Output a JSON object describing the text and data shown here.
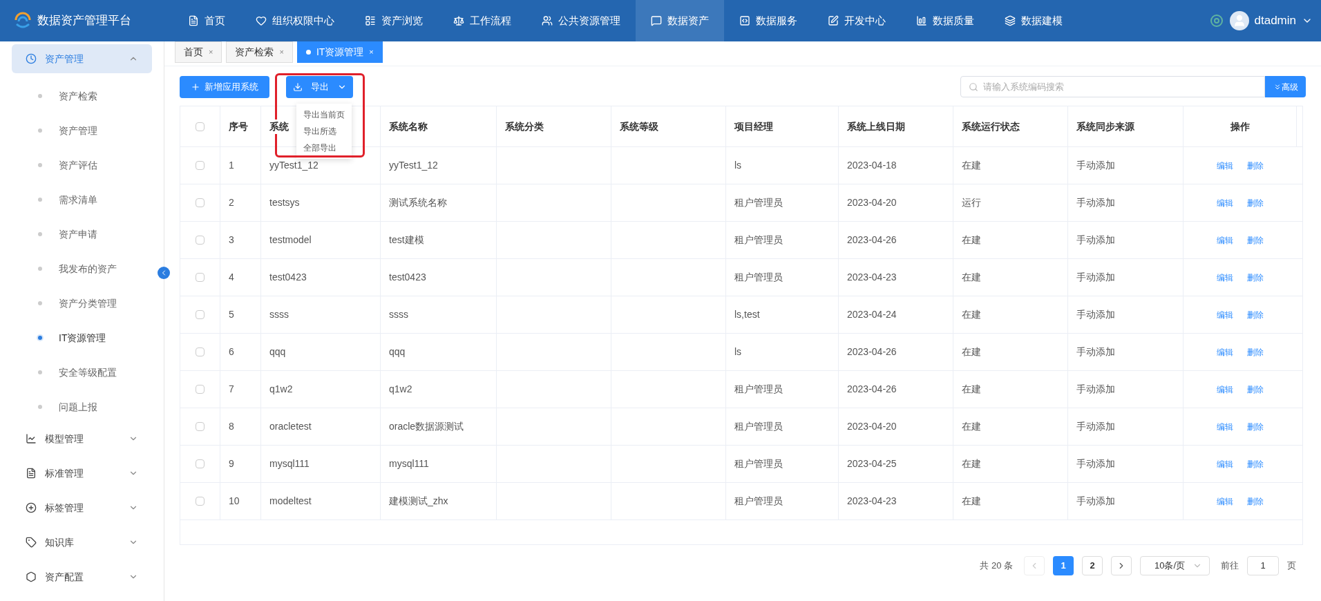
{
  "app": {
    "title": "数据资产管理平台"
  },
  "nav": [
    {
      "label": "首页",
      "selected": false
    },
    {
      "label": "组织权限中心",
      "selected": false
    },
    {
      "label": "资产浏览",
      "selected": false
    },
    {
      "label": "工作流程",
      "selected": false
    },
    {
      "label": "公共资源管理",
      "selected": false
    },
    {
      "label": "数据资产",
      "selected": true
    },
    {
      "label": "数据服务",
      "selected": false
    },
    {
      "label": "开发中心",
      "selected": false
    },
    {
      "label": "数据质量",
      "selected": false
    },
    {
      "label": "数据建模",
      "selected": false
    }
  ],
  "user": {
    "name": "dtadmin"
  },
  "sidebar": [
    {
      "label": "资产管理",
      "expanded": true,
      "selected": true,
      "children": [
        {
          "label": "资产检索",
          "selected": false
        },
        {
          "label": "资产管理",
          "selected": false
        },
        {
          "label": "资产评估",
          "selected": false
        },
        {
          "label": "需求清单",
          "selected": false
        },
        {
          "label": "资产申请",
          "selected": false
        },
        {
          "label": "我发布的资产",
          "selected": false
        },
        {
          "label": "资产分类管理",
          "selected": false
        },
        {
          "label": "IT资源管理",
          "selected": true
        },
        {
          "label": "安全等级配置",
          "selected": false
        },
        {
          "label": "问题上报",
          "selected": false
        }
      ]
    },
    {
      "label": "模型管理",
      "expanded": false,
      "selected": false
    },
    {
      "label": "标准管理",
      "expanded": false,
      "selected": false
    },
    {
      "label": "标签管理",
      "expanded": false,
      "selected": false
    },
    {
      "label": "知识库",
      "expanded": false,
      "selected": false
    },
    {
      "label": "资产配置",
      "expanded": false,
      "selected": false
    }
  ],
  "tabs": [
    {
      "label": "首页",
      "close": "×",
      "selected": false
    },
    {
      "label": "资产检索",
      "close": "×",
      "selected": false
    },
    {
      "label": "IT资源管理",
      "close": "×",
      "selected": true
    }
  ],
  "toolbar": {
    "add": "新增应用系统",
    "export": "导出",
    "export_menu": [
      "导出当前页",
      "导出所选",
      "全部导出"
    ],
    "search_placeholder": "请输入系统编码搜索",
    "advanced": "高级"
  },
  "table": {
    "header_checked": false,
    "columns": [
      "序号",
      "系统",
      "系统名称",
      "系统分类",
      "系统等级",
      "项目经理",
      "系统上线日期",
      "系统运行状态",
      "系统同步来源",
      "操作"
    ],
    "rows": [
      {
        "checked": false,
        "cells": [
          "1",
          "yyTest1_12",
          "yyTest1_12",
          "",
          "",
          "ls",
          "2023-04-18",
          "在建",
          "手动添加"
        ],
        "actions": [
          "编辑",
          "删除"
        ]
      },
      {
        "checked": false,
        "cells": [
          "2",
          "testsys",
          "测试系统名称",
          "",
          "",
          "租户管理员",
          "2023-04-20",
          "运行",
          "手动添加"
        ],
        "actions": [
          "编辑",
          "删除"
        ]
      },
      {
        "checked": false,
        "cells": [
          "3",
          "testmodel",
          "test建模",
          "",
          "",
          "租户管理员",
          "2023-04-26",
          "在建",
          "手动添加"
        ],
        "actions": [
          "编辑",
          "删除"
        ]
      },
      {
        "checked": false,
        "cells": [
          "4",
          "test0423",
          "test0423",
          "",
          "",
          "租户管理员",
          "2023-04-23",
          "在建",
          "手动添加"
        ],
        "actions": [
          "编辑",
          "删除"
        ]
      },
      {
        "checked": false,
        "cells": [
          "5",
          "ssss",
          "ssss",
          "",
          "",
          "ls,test",
          "2023-04-24",
          "在建",
          "手动添加"
        ],
        "actions": [
          "编辑",
          "删除"
        ]
      },
      {
        "checked": false,
        "cells": [
          "6",
          "qqq",
          "qqq",
          "",
          "",
          "ls",
          "2023-04-26",
          "在建",
          "手动添加"
        ],
        "actions": [
          "编辑",
          "删除"
        ]
      },
      {
        "checked": false,
        "cells": [
          "7",
          "q1w2",
          "q1w2",
          "",
          "",
          "租户管理员",
          "2023-04-26",
          "在建",
          "手动添加"
        ],
        "actions": [
          "编辑",
          "删除"
        ]
      },
      {
        "checked": false,
        "cells": [
          "8",
          "oracletest",
          "oracle数据源测试",
          "",
          "",
          "租户管理员",
          "2023-04-20",
          "在建",
          "手动添加"
        ],
        "actions": [
          "编辑",
          "删除"
        ]
      },
      {
        "checked": false,
        "cells": [
          "9",
          "mysql111",
          "mysql111",
          "",
          "",
          "租户管理员",
          "2023-04-25",
          "在建",
          "手动添加"
        ],
        "actions": [
          "编辑",
          "删除"
        ]
      },
      {
        "checked": false,
        "cells": [
          "10",
          "modeltest",
          "建模测试_zhx",
          "",
          "",
          "租户管理员",
          "2023-04-23",
          "在建",
          "手动添加"
        ],
        "actions": [
          "编辑",
          "删除"
        ]
      }
    ]
  },
  "pagination": {
    "total": "共 20 条",
    "pages": [
      {
        "label": "1",
        "selected": true
      },
      {
        "label": "2",
        "selected": false
      }
    ],
    "page_size": "10条/页",
    "goto_label": "前往",
    "goto_value": "1",
    "goto_suffix": "页"
  }
}
